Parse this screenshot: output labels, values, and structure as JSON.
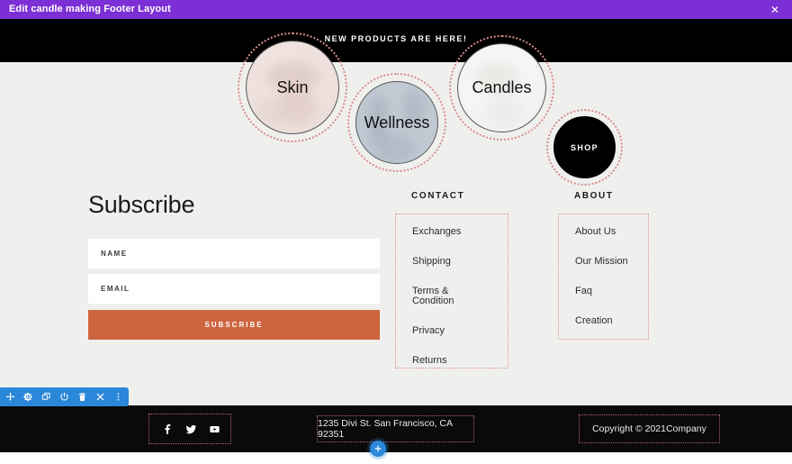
{
  "window": {
    "title": "Edit candle making Footer Layout",
    "close_label": "✕",
    "accent_purple": "#7b2fd4"
  },
  "hero": {
    "banner_text": "NEW PRODUCTS ARE HERE!",
    "circles": [
      {
        "label": "Skin",
        "kind": "photo-circle"
      },
      {
        "label": "Wellness",
        "kind": "photo-circle"
      },
      {
        "label": "Candles",
        "kind": "photo-circle"
      },
      {
        "label": "SHOP",
        "kind": "shop-circle"
      }
    ]
  },
  "subscribe": {
    "heading": "Subscribe",
    "name_placeholder": "NAME",
    "name_value": "",
    "email_placeholder": "EMAIL",
    "email_value": "",
    "button_label": "SUBSCRIBE",
    "button_color": "#cd6640"
  },
  "columns": [
    {
      "heading": "CONTACT",
      "links": [
        "Exchanges",
        "Shipping",
        "Terms & Condition",
        "Privacy",
        "Returns"
      ]
    },
    {
      "heading": "ABOUT",
      "links": [
        "About Us",
        "Our Mission",
        "Faq",
        "Creation"
      ]
    }
  ],
  "footer": {
    "social": [
      "facebook-icon",
      "twitter-icon",
      "youtube-icon"
    ],
    "address": "1235 Divi St. San Francisco, CA 92351",
    "copyright": "Copyright © 2021Company"
  },
  "toolbar": {
    "color": "#2b87da",
    "items": [
      "move-icon",
      "gear-icon",
      "duplicate-icon",
      "power-icon",
      "trash-icon",
      "close-icon",
      "more-options-icon"
    ]
  },
  "add_button": {
    "label": "+"
  }
}
